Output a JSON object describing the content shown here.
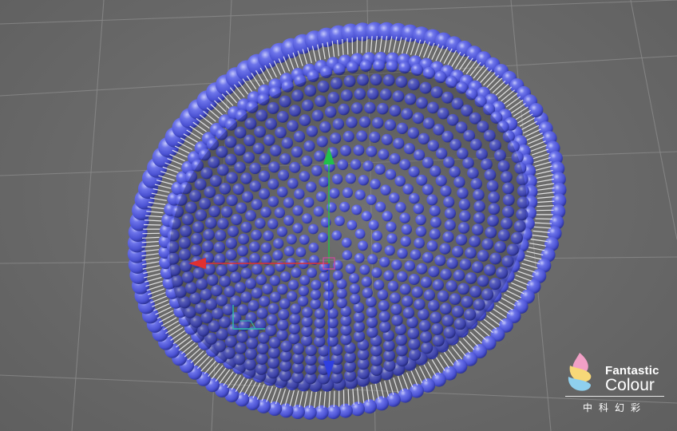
{
  "viewport": {
    "background_color": "#6b6b6b",
    "grid_line_color": "#8a8a8a"
  },
  "model": {
    "description_name": "lipid-bilayer-hemisphere",
    "sphere_color": "#4f56d6",
    "sphere_highlight": "#a9aef5",
    "sphere_shadow": "#262c8a",
    "tail_color": "#f2f2f2"
  },
  "axes": {
    "x_color": "#e03030",
    "y_color": "#22c04a",
    "z_color": "#2f3fe0"
  },
  "watermark": {
    "brand_line1": "Fantastic",
    "brand_line2": "Colour",
    "brand_cn": "中科幻彩",
    "logo_colors": [
      "#f2a0c6",
      "#f7d878",
      "#8fd0ee"
    ]
  }
}
